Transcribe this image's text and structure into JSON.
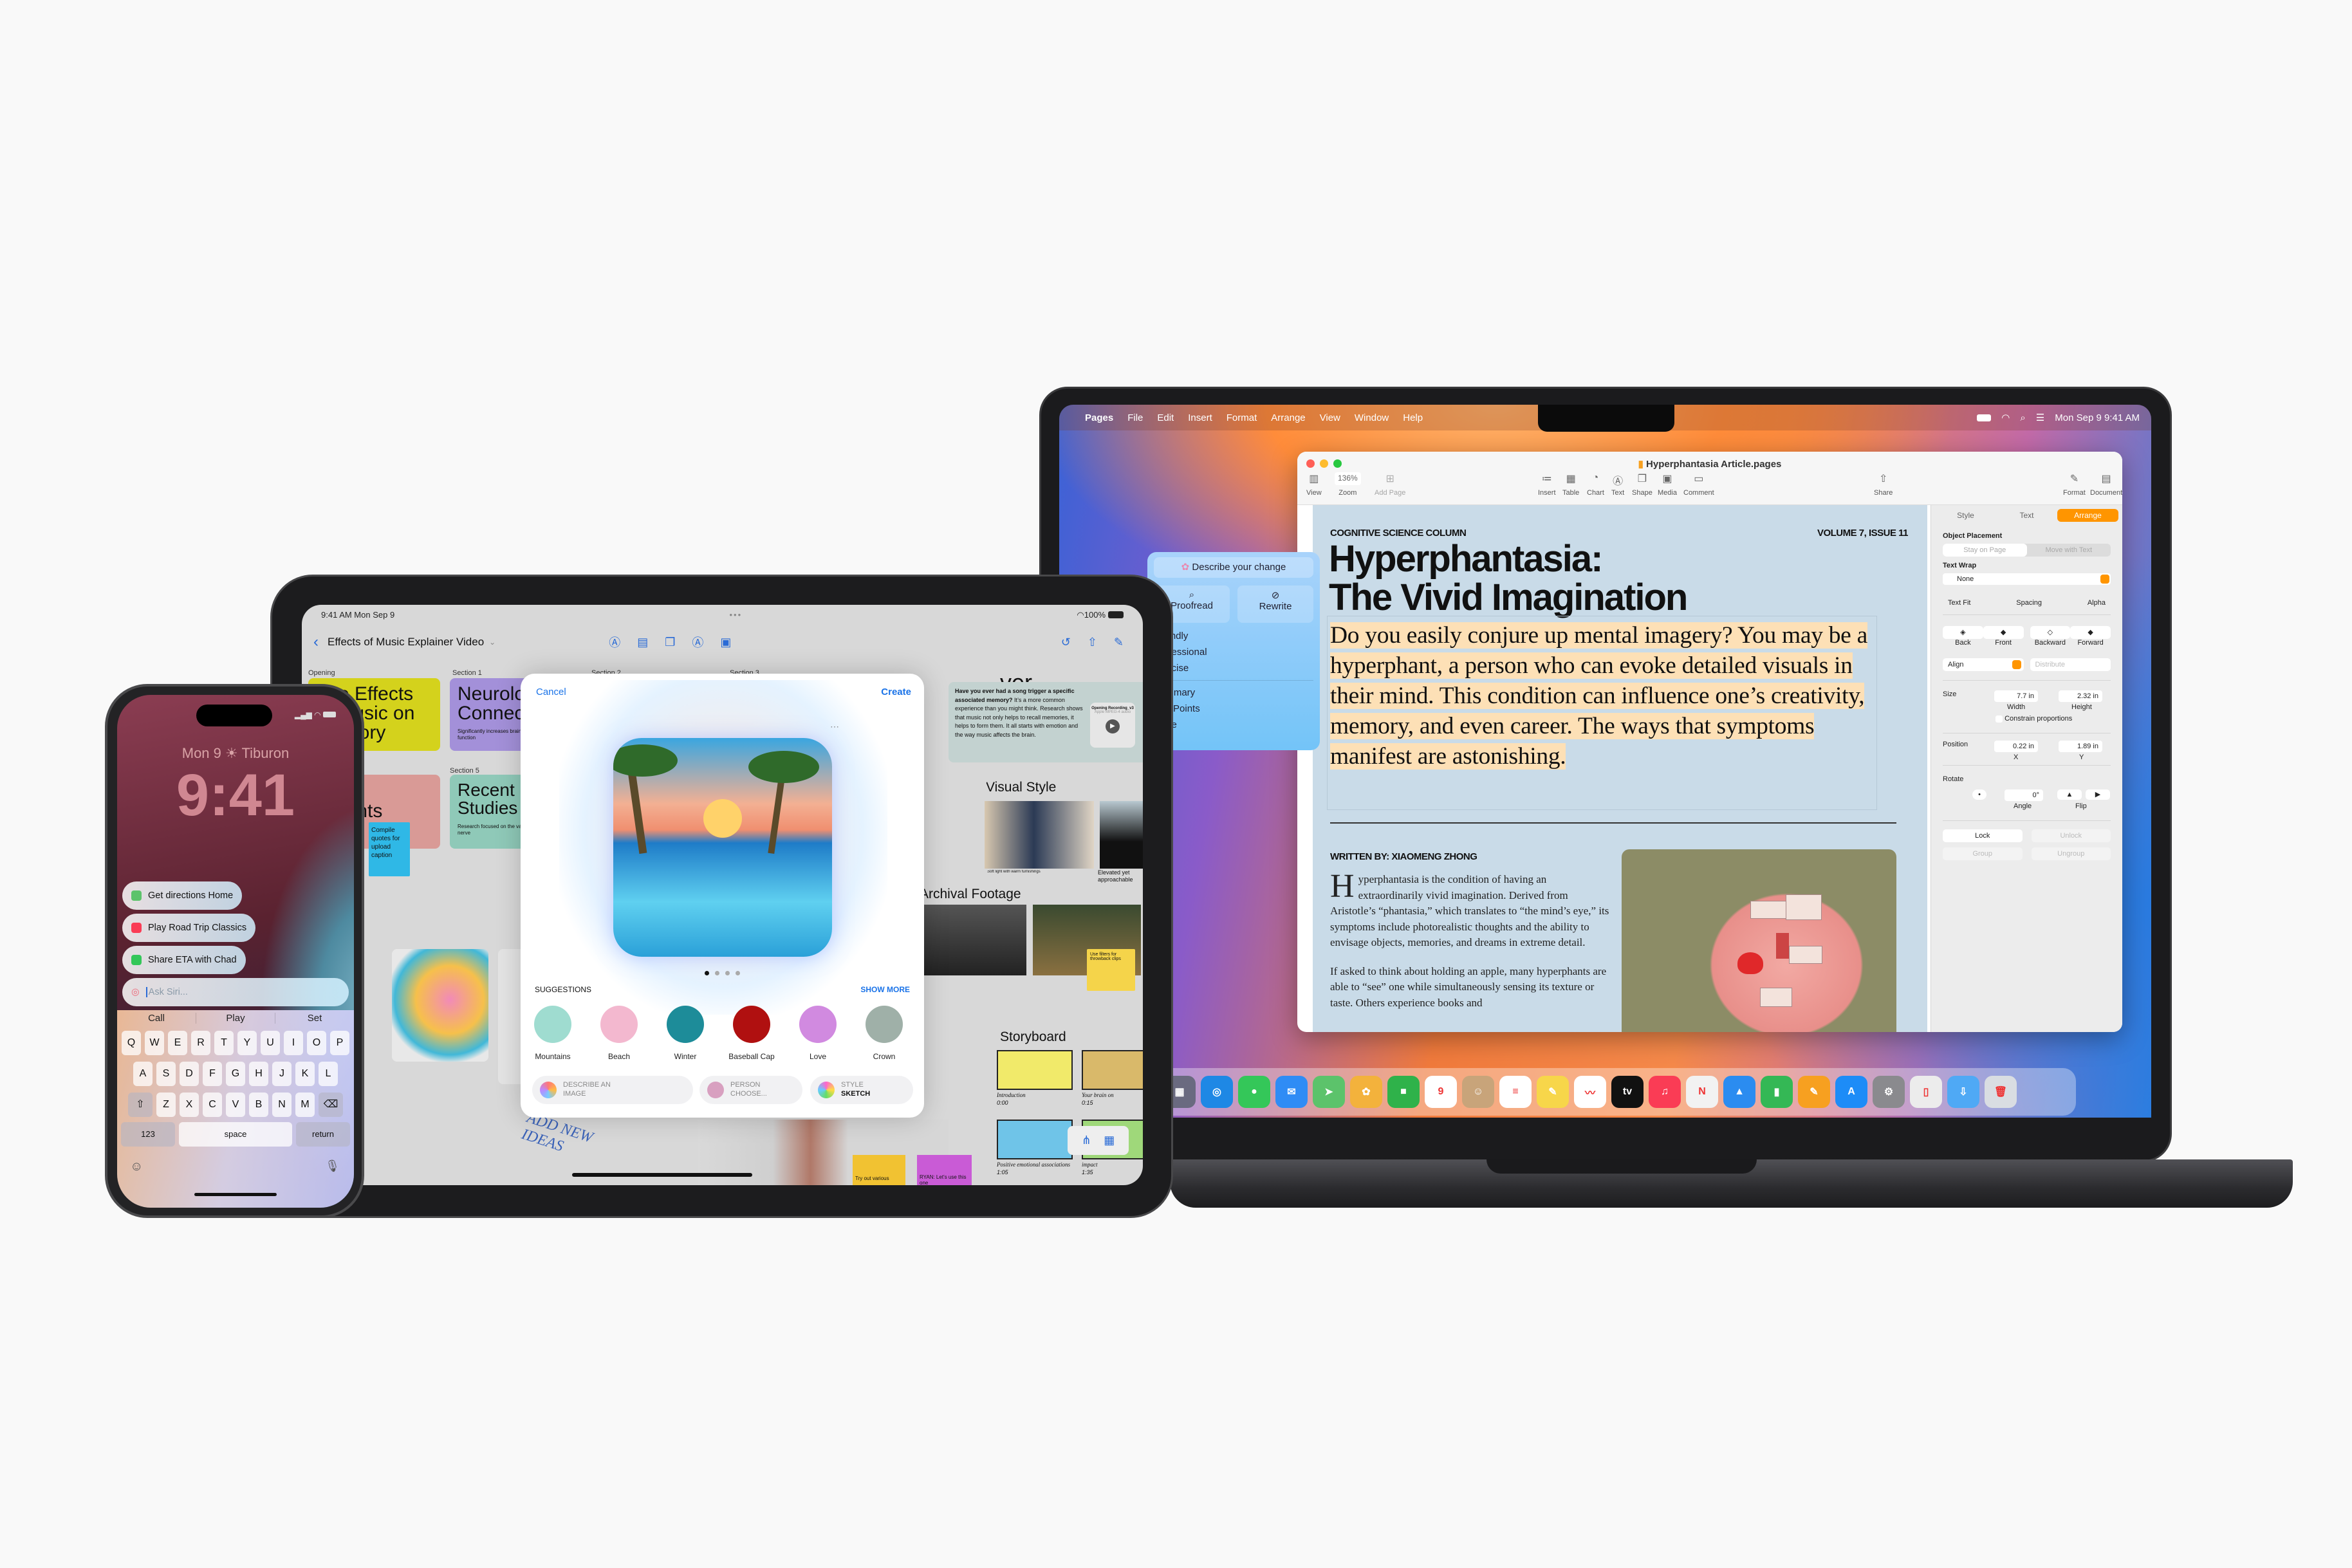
{
  "mac": {
    "menubar": {
      "apple_icon": "apple-logo-icon",
      "app": "Pages",
      "items": [
        "File",
        "Edit",
        "Insert",
        "Format",
        "Arrange",
        "View",
        "Window",
        "Help"
      ],
      "datetime": "Mon Sep 9  9:41 AM"
    },
    "window": {
      "title": "Hyperphantasia Article.pages",
      "toolbar": {
        "view": "View",
        "zoom_value": "136%",
        "zoom": "Zoom",
        "add_page": "Add Page",
        "insert": "Insert",
        "table": "Table",
        "chart": "Chart",
        "text": "Text",
        "shape": "Shape",
        "media": "Media",
        "comment": "Comment",
        "share": "Share",
        "format": "Format",
        "document": "Document"
      },
      "doc": {
        "column": "COGNITIVE SCIENCE COLUMN",
        "issue": "VOLUME 7, ISSUE 11",
        "title_1": "Hyperphantasia:",
        "title_2": "The Vivid Imagination",
        "lede": "Do you easily conjure up mental imagery? You may be a hyperphant, a person who can evoke detailed visuals in their mind. This condition can influence one’s creativity, memory, and even career. The ways that symptoms manifest are astonishing.",
        "byline": "WRITTEN BY: XIAOMENG ZHONG",
        "drop_cap": "H",
        "para1": "yperphantasia is the condition of having an extraordinarily vivid imagination. Derived from Aristotle’s “phantasia,” which translates to “the mind’s eye,” its symptoms include photorealistic thoughts and the ability to envisage objects, memories, and dreams in extreme detail.",
        "para2": "If asked to think about holding an apple, many hyperphants are able to “see” one while simultaneously sensing its texture or taste. Others experience books and"
      },
      "sidebar": {
        "tabs": [
          "Style",
          "Text",
          "Arrange"
        ],
        "active_tab": "Arrange",
        "accent": "#ff9500",
        "object_placement": "Object Placement",
        "stay_on_page": "Stay on Page",
        "move_with_text": "Move with Text",
        "text_wrap": "Text Wrap",
        "wrap_value": "None",
        "text_fit": "Text Fit",
        "spacing": "Spacing",
        "alpha": "Alpha",
        "back": "Back",
        "front": "Front",
        "backward": "Backward",
        "forward": "Forward",
        "align": "Align",
        "distribute": "Distribute",
        "size": "Size",
        "width": "7.7 in",
        "width_label": "Width",
        "height": "2.32 in",
        "height_label": "Height",
        "constrain": "Constrain proportions",
        "position": "Position",
        "x": "0.22 in",
        "x_label": "X",
        "y": "1.89 in",
        "y_label": "Y",
        "rotate": "Rotate",
        "angle": "0°",
        "angle_label": "Angle",
        "flip": "Flip",
        "lock": "Lock",
        "unlock": "Unlock",
        "group": "Group",
        "ungroup": "Ungroup"
      }
    },
    "writing_tools": {
      "describe": "Describe your change",
      "proofread": "Proofread",
      "rewrite": "Rewrite",
      "tones": [
        "Friendly",
        "Professional",
        "Concise"
      ],
      "formats": [
        "Summary",
        "Key Points",
        "Table",
        "List"
      ]
    },
    "dock": [
      {
        "name": "launchpad",
        "color": "#6a6a80",
        "glyph": "▦"
      },
      {
        "name": "safari",
        "color": "#1e88e5",
        "glyph": "◎"
      },
      {
        "name": "messages",
        "color": "#34c759",
        "glyph": "●"
      },
      {
        "name": "mail",
        "color": "#2f8cf5",
        "glyph": "✉"
      },
      {
        "name": "maps",
        "color": "#5cc36b",
        "glyph": "➤"
      },
      {
        "name": "photos",
        "color": "#f3b23c",
        "glyph": "✿"
      },
      {
        "name": "facetime",
        "color": "#2fb24a",
        "glyph": "■"
      },
      {
        "name": "calendar",
        "color": "#ffffff",
        "glyph": "9"
      },
      {
        "name": "contacts",
        "color": "#c8a47a",
        "glyph": "☺"
      },
      {
        "name": "reminders",
        "color": "#ffffff",
        "glyph": "≡"
      },
      {
        "name": "notes",
        "color": "#f7d64a",
        "glyph": "✎"
      },
      {
        "name": "freeform",
        "color": "#ffffff",
        "glyph": "〰"
      },
      {
        "name": "tv",
        "color": "#111111",
        "glyph": "tv"
      },
      {
        "name": "music",
        "color": "#fa3c55",
        "glyph": "♫"
      },
      {
        "name": "news",
        "color": "#f2f2f2",
        "glyph": "N"
      },
      {
        "name": "keynote",
        "color": "#2b8cf0",
        "glyph": "▲"
      },
      {
        "name": "numbers",
        "color": "#34b855",
        "glyph": "▮"
      },
      {
        "name": "pages",
        "color": "#f7a020",
        "glyph": "✎"
      },
      {
        "name": "app-store",
        "color": "#1d8cf7",
        "glyph": "A"
      },
      {
        "name": "system-settings",
        "color": "#8a8a8e",
        "glyph": "⚙"
      },
      {
        "name": "iphone-mirroring",
        "color": "#ececec",
        "glyph": "▯"
      },
      {
        "name": "downloads",
        "color": "#4fa9f5",
        "glyph": "⇩"
      },
      {
        "name": "trash",
        "color": "#d9dde2",
        "glyph": "🗑"
      }
    ]
  },
  "ipad": {
    "status": {
      "time": "9:41 AM  Mon Sep 9",
      "battery": "100%"
    },
    "board_title": "Effects of Music Explainer Video",
    "sections": [
      "Opening",
      "Section 1",
      "Section 2",
      "Section 3",
      "Section 5"
    ],
    "cards": {
      "opening": "The Effects of Music on Memory",
      "section1": "Neurological Connections",
      "section1_sub": "Significantly increases brain function",
      "pink": "Insights",
      "blue_note": "Compile quotes for upload caption",
      "section5": "Recent Studies",
      "section5_sub": "Research focused on the vagus nerve",
      "partial_word": "ver",
      "quote_bold": "Have you ever had a song trigger a specific associated memory?",
      "quote": " It’s a more common experience than you might think. Research shows that music not only helps to recall memories, it helps to form them. It all starts with emotion and the way music affects the brain.",
      "audio_title": "Opening Recording_v3",
      "audio_sub": "Apple MPEG-4 audio",
      "visual_style": "Visual Style",
      "photo1_caption": "Soft light with warm furnishings",
      "photo2_caption": "Elevated yet approachable",
      "archival": "Archival Footage",
      "sticky_archival": "Use filters for throwback clips",
      "storyboard": "Storyboard",
      "frames": [
        {
          "label": "Introduction",
          "time": "0:00"
        },
        {
          "label": "Your brain on",
          "time": "0:15"
        },
        {
          "label": "Positive emotional associations",
          "time": "1:05"
        },
        {
          "label": "impact",
          "time": "1:35"
        }
      ],
      "add_ideas": "ADD NEW IDEAS",
      "sticky_yellow": "Try out various",
      "sticky_purple": "RYAN: Let’s use this one"
    },
    "playground": {
      "cancel": "Cancel",
      "create": "Create",
      "accent": "#1a73e8",
      "suggestions_label": "SUGGESTIONS",
      "show_more": "SHOW MORE",
      "suggestions": [
        {
          "label": "Mountains",
          "color": "#9fdcd0"
        },
        {
          "label": "Beach",
          "color": "#f3b8cf"
        },
        {
          "label": "Winter",
          "color": "#1d8c99"
        },
        {
          "label": "Baseball Cap",
          "color": "#b01010"
        },
        {
          "label": "Love",
          "color": "#d18ae0"
        },
        {
          "label": "Crown",
          "color": "#9fb0a8"
        }
      ],
      "pills": [
        {
          "top": "DESCRIBE AN",
          "bottom": "IMAGE"
        },
        {
          "top": "PERSON",
          "bottom": "CHOOSE..."
        },
        {
          "top": "STYLE",
          "bottom": "SKETCH"
        }
      ],
      "page": 1,
      "pages": 4
    }
  },
  "iphone": {
    "date_line": "Mon 9  ☀  Tiburon",
    "time": "9:41",
    "suggestions": [
      {
        "text": "Get directions Home",
        "icon": "maps-icon",
        "color": "#5cc36b"
      },
      {
        "text": "Play Road Trip Classics",
        "icon": "music-icon",
        "color": "#fa3c55"
      },
      {
        "text": "Share ETA with Chad",
        "icon": "messages-icon",
        "color": "#34c759"
      }
    ],
    "siri_placeholder": "Ask Siri...",
    "predictions": [
      "Call",
      "Play",
      "Set"
    ],
    "keys": [
      [
        "Q",
        "W",
        "E",
        "R",
        "T",
        "Y",
        "U",
        "I",
        "O",
        "P"
      ],
      [
        "A",
        "S",
        "D",
        "F",
        "G",
        "H",
        "J",
        "K",
        "L"
      ],
      [
        "Z",
        "X",
        "C",
        "V",
        "B",
        "N",
        "M"
      ]
    ],
    "numbers_key": "123",
    "space_key": "space",
    "return_key": "return"
  }
}
